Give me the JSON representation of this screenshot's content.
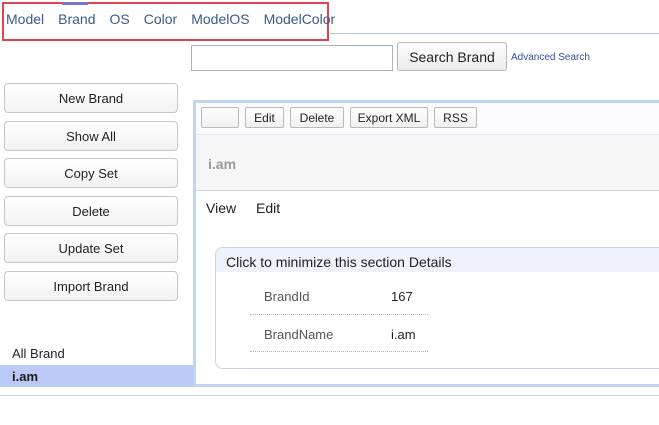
{
  "nav": {
    "items": [
      "Model",
      "Brand",
      "OS",
      "Color",
      "ModelOS",
      "ModelColor"
    ]
  },
  "search": {
    "value": "",
    "placeholder": "",
    "button_label": "Search Brand",
    "advanced_label": "Advanced Search"
  },
  "sidebar": {
    "actions": [
      "New Brand",
      "Show All",
      "Copy Set",
      "Delete",
      "Update Set",
      "Import Brand"
    ],
    "list_label": "All Brand",
    "selected_item": "i.am"
  },
  "toolbar": {
    "blank_label": "",
    "edit_label": "Edit",
    "delete_label": "Delete",
    "export_label": "Export XML",
    "rss_label": "RSS"
  },
  "record": {
    "title": "i.am"
  },
  "tabs": [
    "View",
    "Edit"
  ],
  "details": {
    "header": "Click to minimize this section Details",
    "fields": [
      {
        "label": "BrandId",
        "value": "167"
      },
      {
        "label": "BrandName",
        "value": "i.am"
      }
    ]
  },
  "colors": {
    "accent_link": "#3a5a8a",
    "highlight_border": "#e0424f",
    "selected_row": "#bcc8f5",
    "panel_border": "#c3d1f3"
  }
}
